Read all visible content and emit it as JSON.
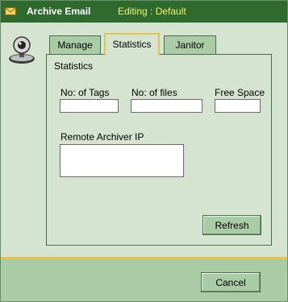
{
  "window": {
    "title": "Archive Email",
    "subtitle": "Editing : Default"
  },
  "tabs": [
    {
      "label": "Manage",
      "active": false
    },
    {
      "label": "Statistics",
      "active": true
    },
    {
      "label": "Janitor",
      "active": false
    }
  ],
  "panel": {
    "group_title": "Statistics",
    "tags_label": "No: of Tags",
    "tags_value": "",
    "files_label": "No: of files",
    "files_value": "",
    "free_space_label": "Free Space",
    "free_space_value": "",
    "remote_ip_label": "Remote Archiver IP",
    "remote_ip_value": "",
    "refresh_label": "Refresh"
  },
  "footer": {
    "cancel_label": "Cancel"
  },
  "colors": {
    "title_bar": "#2f6b2f",
    "editing_text": "#f1f16a",
    "panel_bg": "#d4e4d0",
    "tab_bg": "#a9cca6",
    "active_tab_border": "#e6c44a"
  },
  "icons": {
    "title": "envelope-icon",
    "side": "webcam-icon"
  }
}
